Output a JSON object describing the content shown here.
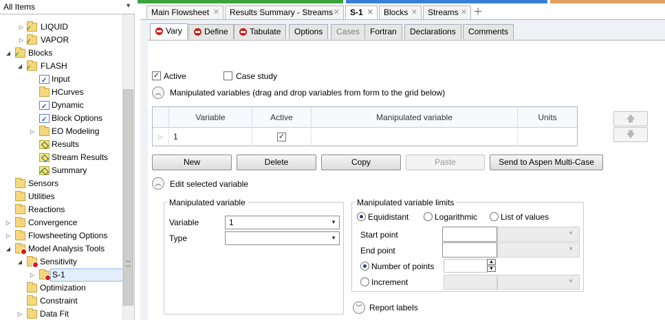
{
  "nav": {
    "filter": "All Items",
    "tree": [
      {
        "label": "LIQUID",
        "icon": "stream-folder-icon"
      },
      {
        "label": "VAPOR",
        "icon": "stream-folder-icon"
      },
      {
        "label": "Blocks",
        "icon": "folder-check-icon"
      },
      {
        "label": "FLASH",
        "icon": "folder-check-icon"
      },
      {
        "label": "Input",
        "icon": "form-check-icon"
      },
      {
        "label": "HCurves",
        "icon": "folder-icon"
      },
      {
        "label": "Dynamic",
        "icon": "form-check-icon"
      },
      {
        "label": "Block Options",
        "icon": "form-check-icon"
      },
      {
        "label": "EO Modeling",
        "icon": "folder-icon"
      },
      {
        "label": "Results",
        "icon": "results-icon"
      },
      {
        "label": "Stream Results",
        "icon": "results-icon"
      },
      {
        "label": "Summary",
        "icon": "results-check-icon"
      },
      {
        "label": "Sensors",
        "icon": "folder-icon"
      },
      {
        "label": "Utilities",
        "icon": "folder-icon"
      },
      {
        "label": "Reactions",
        "icon": "folder-icon"
      },
      {
        "label": "Convergence",
        "icon": "folder-icon"
      },
      {
        "label": "Flowsheeting Options",
        "icon": "folder-icon"
      },
      {
        "label": "Model Analysis Tools",
        "icon": "folder-error-icon"
      },
      {
        "label": "Sensitivity",
        "icon": "folder-error-icon"
      },
      {
        "label": "S-1",
        "icon": "folder-error-icon"
      },
      {
        "label": "Optimization",
        "icon": "folder-icon"
      },
      {
        "label": "Constraint",
        "icon": "folder-icon"
      },
      {
        "label": "Data Fit",
        "icon": "folder-icon"
      }
    ]
  },
  "doc_tabs": [
    "Main Flowsheet",
    "Results Summary - Streams",
    "S-1",
    "Blocks",
    "Streams"
  ],
  "form_tabs": [
    "Vary",
    "Define",
    "Tabulate",
    "Options",
    "Cases",
    "Fortran",
    "Declarations",
    "Comments"
  ],
  "vary": {
    "active_label": "Active",
    "case_study_label": "Case study",
    "manip_section": "Manipulated variables (drag and drop variables from form to the grid below)",
    "grid_headers": [
      "Variable",
      "Active",
      "Manipulated variable",
      "Units"
    ],
    "grid_row": {
      "variable": "1",
      "active": true,
      "manipulated": "",
      "units": ""
    },
    "buttons": [
      "New",
      "Delete",
      "Copy",
      "Paste",
      "Send to Aspen Multi-Case"
    ],
    "edit_section": "Edit selected variable",
    "mv_group": "Manipulated variable",
    "variable_label": "Variable",
    "variable_value": "1",
    "type_label": "Type",
    "type_value": "",
    "limits_group": "Manipulated variable limits",
    "radio_equidistant": "Equidistant",
    "radio_log": "Logarithmic",
    "radio_list": "List of values",
    "start_label": "Start point",
    "end_label": "End point",
    "npoints_label": "Number of points",
    "increment_label": "Increment",
    "report_labels": "Report labels"
  },
  "colors": {
    "strip_green": "#3aa33a",
    "strip_blue": "#3b7fd4",
    "strip_orange": "#e0a060",
    "error_red": "#d21b1b"
  }
}
